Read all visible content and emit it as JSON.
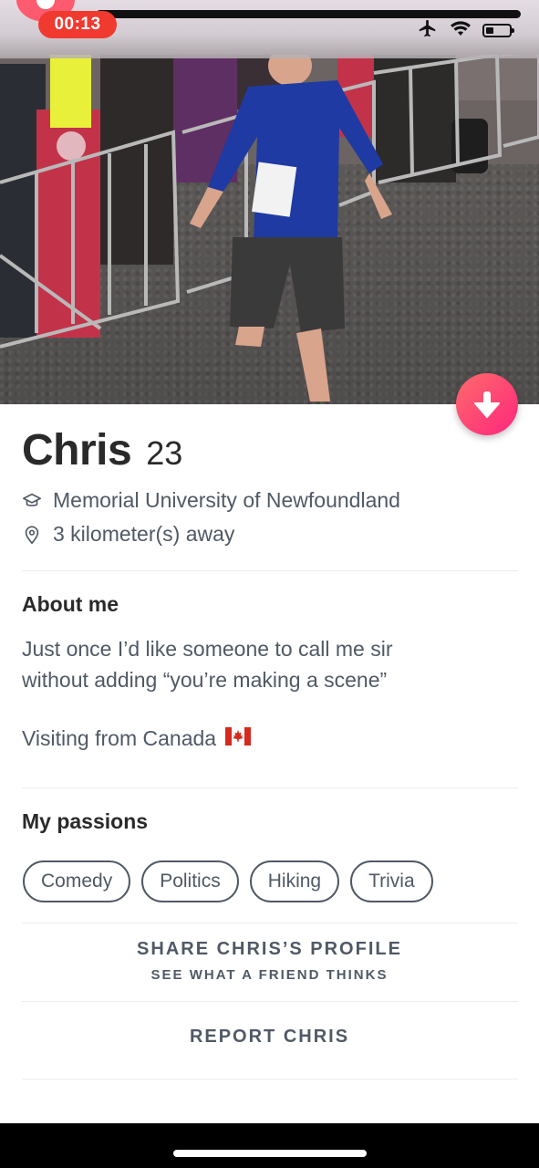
{
  "status_bar": {
    "recording_time": "00:13",
    "icons": [
      "airplane-mode-icon",
      "wifi-icon",
      "battery-icon"
    ],
    "battery_level": 0.2
  },
  "photo": {
    "description_icon": "profile-photo"
  },
  "profile": {
    "name": "Chris",
    "age": "23",
    "school": "Memorial University of Newfoundland",
    "distance": "3 kilometer(s) away"
  },
  "about": {
    "title": "About me",
    "lines": [
      "Just once I’d like someone to call me sir",
      "without adding “you’re making a scene”"
    ],
    "visiting": "Visiting from Canada"
  },
  "passions": {
    "title": "My passions",
    "items": [
      "Comedy",
      "Politics",
      "Hiking",
      "Trivia"
    ]
  },
  "actions": {
    "share_label": "SHARE CHRIS’S PROFILE",
    "share_sub": "SEE WHAT A FRIEND THINKS",
    "report_label": "REPORT CHRIS"
  },
  "colors": {
    "accent_gradient_start": "#ff6b6b",
    "accent_gradient_end": "#fd267d",
    "text_primary": "#2a2a2a",
    "text_secondary": "#505965"
  }
}
